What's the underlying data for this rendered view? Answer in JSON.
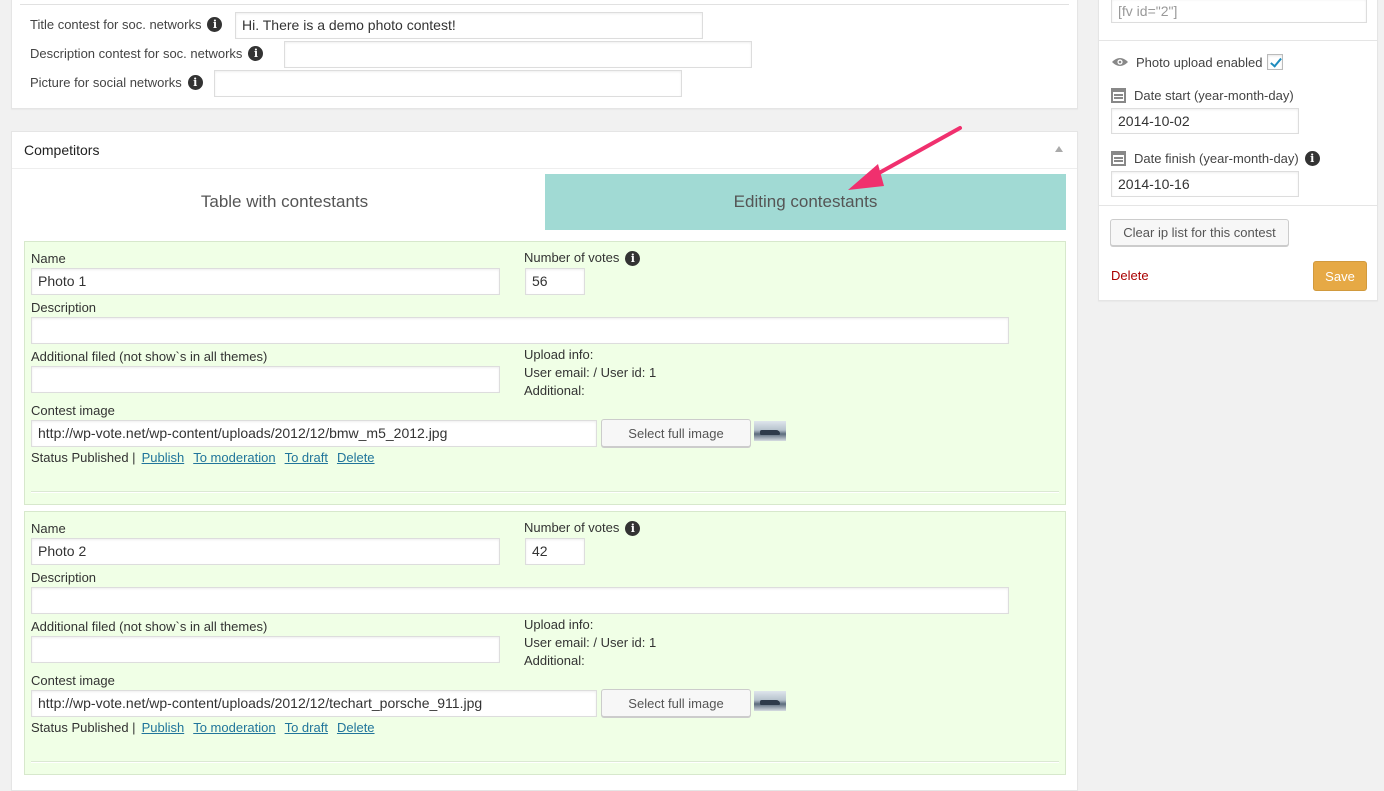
{
  "social": {
    "title_label": "Title contest for soc. networks",
    "title_value": "Hi. There is a demo photo contest!",
    "description_label": "Description contest for soc. networks",
    "description_value": "",
    "picture_label": "Picture for social networks",
    "picture_value": ""
  },
  "competitors": {
    "heading": "Competitors",
    "tabs": [
      "Table with contestants",
      "Editing contestants"
    ],
    "active_tab": "Editing contestants",
    "labels": {
      "name": "Name",
      "votes": "Number of votes",
      "description": "Description",
      "additional": "Additional filed (not show`s in all themes)",
      "upload_info": "Upload info:",
      "user_info": "User email: / User id: 1",
      "additional_info": "Additional:",
      "contest_image": "Contest image",
      "select_full_image": "Select full image",
      "status_prefix": "Status Published |",
      "publish": "Publish",
      "to_moderation": "To moderation",
      "to_draft": "To draft",
      "delete": "Delete"
    },
    "items": [
      {
        "name": "Photo 1",
        "votes": "56",
        "description": "",
        "additional": "",
        "image_url": "http://wp-vote.net/wp-content/uploads/2012/12/bmw_m5_2012.jpg"
      },
      {
        "name": "Photo 2",
        "votes": "42",
        "description": "",
        "additional": "",
        "image_url": "http://wp-vote.net/wp-content/uploads/2012/12/techart_porsche_911.jpg"
      }
    ]
  },
  "sidebar": {
    "shortcode_value": "[fv id=\"2\"]",
    "photo_upload_label": "Photo upload enabled",
    "photo_upload_checked": true,
    "date_start_label": "Date start (year-month-day)",
    "date_start_value": "2014-10-02",
    "date_finish_label": "Date finish (year-month-day)",
    "date_finish_value": "2014-10-16",
    "clear_ip_label": "Clear ip list for this contest",
    "delete_label": "Delete",
    "save_label": "Save"
  },
  "colors": {
    "active_tab": "#a1dad4",
    "card_bg": "#f0ffe6",
    "save_button": "#e6a945",
    "link": "#21759b",
    "delete_link": "#aa0000",
    "annotation_arrow": "#f0306e"
  }
}
